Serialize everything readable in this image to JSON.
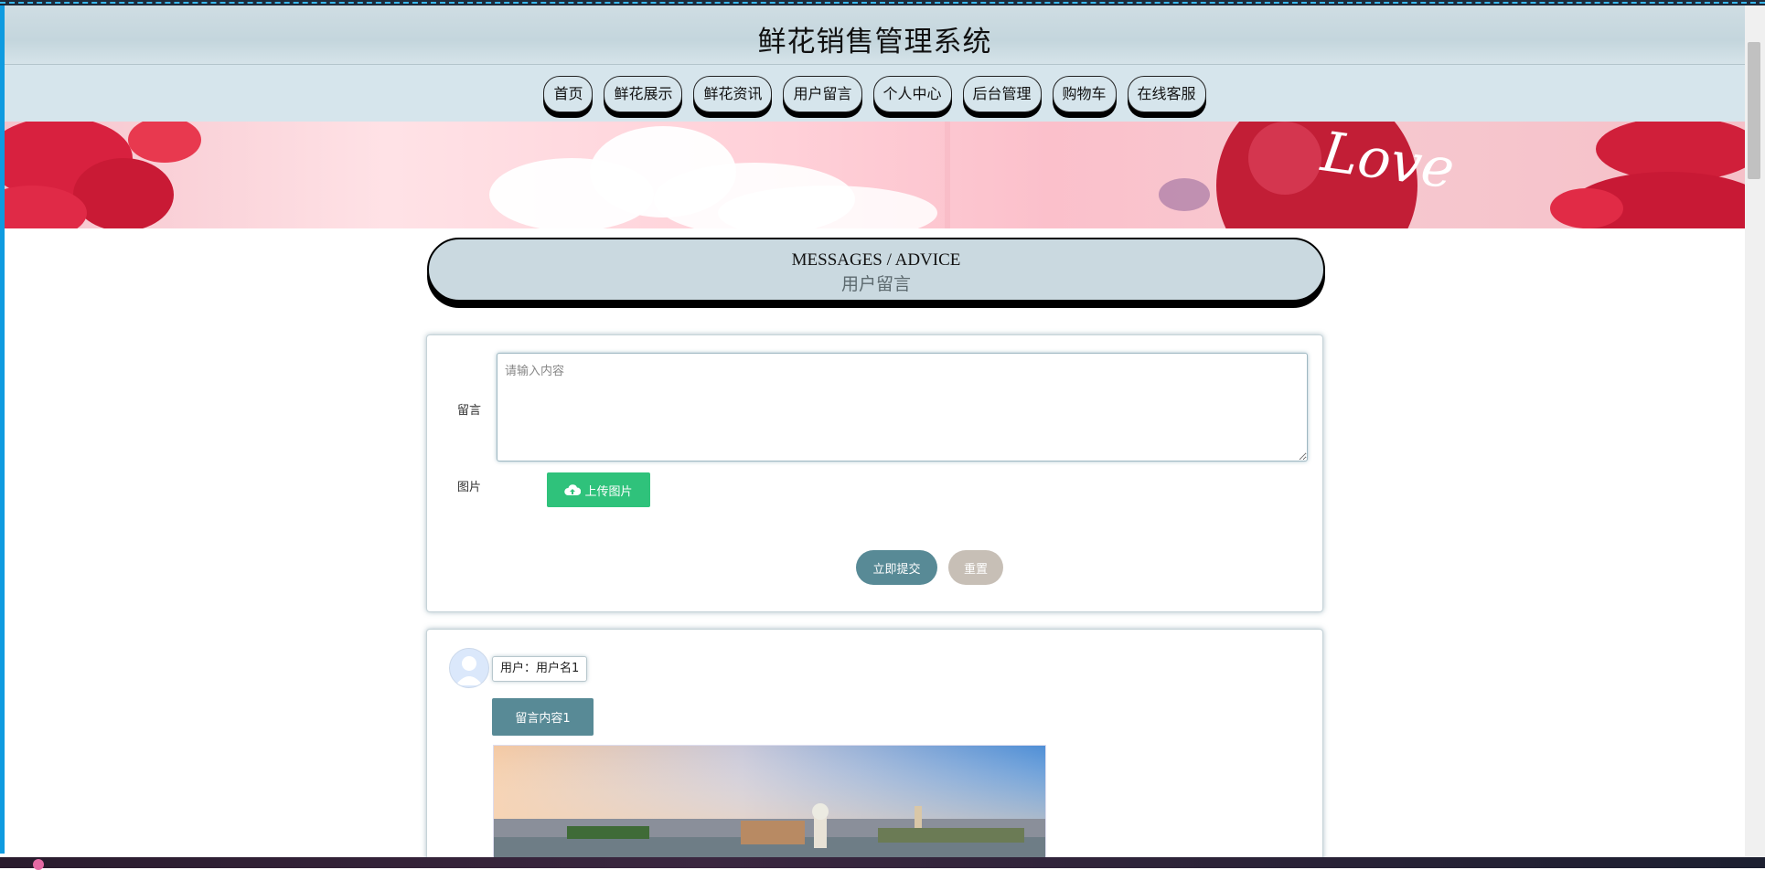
{
  "header": {
    "title": "鲜花销售管理系统"
  },
  "nav": {
    "items": [
      "首页",
      "鲜花展示",
      "鲜花资讯",
      "用户留言",
      "个人中心",
      "后台管理",
      "购物车",
      "在线客服"
    ]
  },
  "banner": {
    "text": "Love"
  },
  "section": {
    "title_en": "MESSAGES / ADVICE",
    "title_cn": "用户留言"
  },
  "form": {
    "message_label": "留言",
    "message_placeholder": "请输入内容",
    "image_label": "图片",
    "upload_label": "上传图片",
    "submit_label": "立即提交",
    "reset_label": "重置"
  },
  "messages": [
    {
      "user": "用户：用户名1",
      "content": "留言内容1"
    }
  ],
  "colors": {
    "header_bg": "#c4d6dd",
    "nav_bg": "#d6e5ec",
    "upload_green": "#2fc27b",
    "submit_teal": "#588a96",
    "reset_beige": "#c7bfb6"
  },
  "icons": {
    "upload": "cloud-upload-icon",
    "avatar": "user-avatar-icon"
  }
}
